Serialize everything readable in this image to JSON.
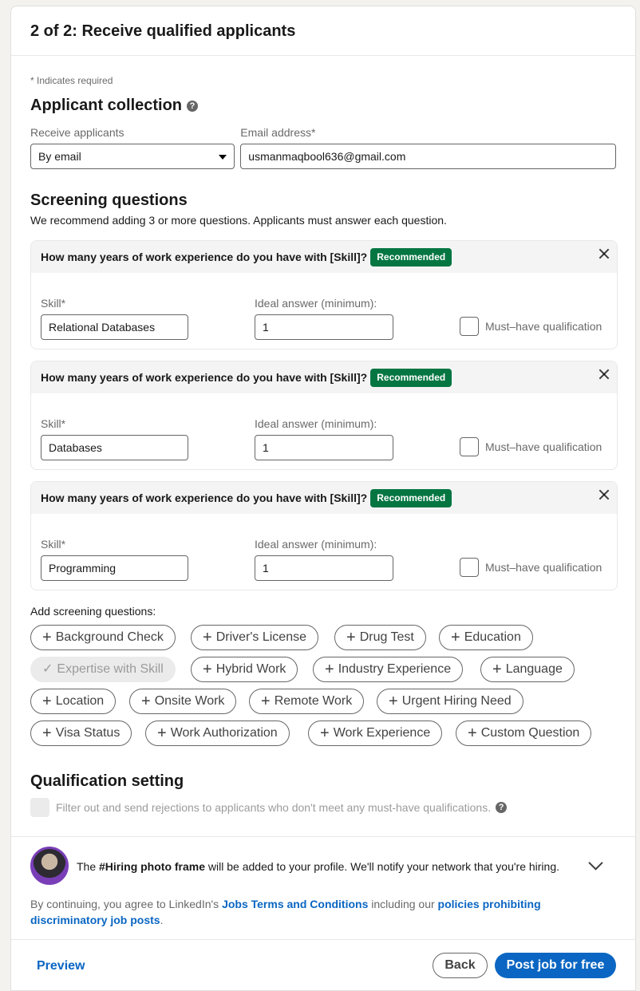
{
  "header": {
    "title": "2 of 2: Receive qualified applicants"
  },
  "required_note": "* Indicates required",
  "applicant_collection": {
    "title": "Applicant collection",
    "receive_label": "Receive applicants",
    "receive_value": "By email",
    "email_label": "Email address*",
    "email_value": "usmanmaqbool636@gmail.com"
  },
  "screening": {
    "title": "Screening questions",
    "subtitle": "We recommend adding 3 or more questions. Applicants must answer each question.",
    "questions": [
      {
        "text": "How many years of work experience do you have with [Skill]?",
        "badge": "Recommended",
        "skill_label": "Skill*",
        "skill_value": "Relational Databases",
        "answer_label": "Ideal answer (minimum):",
        "answer_value": "1",
        "must_have": "Must–have qualification"
      },
      {
        "text": "How many years of work experience do you have with [Skill]?",
        "badge": "Recommended",
        "skill_label": "Skill*",
        "skill_value": "Databases",
        "answer_label": "Ideal answer (minimum):",
        "answer_value": "1",
        "must_have": "Must–have qualification"
      },
      {
        "text": "How many years of work experience do you have with [Skill]?",
        "badge": "Recommended",
        "skill_label": "Skill*",
        "skill_value": "Programming",
        "answer_label": "Ideal answer (minimum):",
        "answer_value": "1",
        "must_have": "Must–have qualification"
      }
    ],
    "add_label": "Add screening questions:",
    "chips": [
      "Background Check",
      "Driver's License",
      "Drug Test",
      "Education",
      "Expertise with Skill",
      "Hybrid Work",
      "Industry Experience",
      "Language",
      "Location",
      "Onsite Work",
      "Remote Work",
      "Urgent Hiring Need",
      "Visa Status",
      "Work Authorization",
      "Work Experience",
      "Custom Question"
    ]
  },
  "qualification": {
    "title": "Qualification setting",
    "filter_label": "Filter out and send rejections to applicants who don't meet any must-have qualifications."
  },
  "hiring": {
    "prefix": "The ",
    "bold": "#Hiring photo frame",
    "suffix": " will be added to your profile. We'll notify your network that you're hiring."
  },
  "terms": {
    "t1": "By continuing, you agree to LinkedIn's ",
    "link1": "Jobs Terms and Conditions",
    "t2": " including our ",
    "link2": "policies prohibiting discriminatory job posts",
    "t3": "."
  },
  "footer": {
    "preview": "Preview",
    "back": "Back",
    "post": "Post job for free"
  }
}
